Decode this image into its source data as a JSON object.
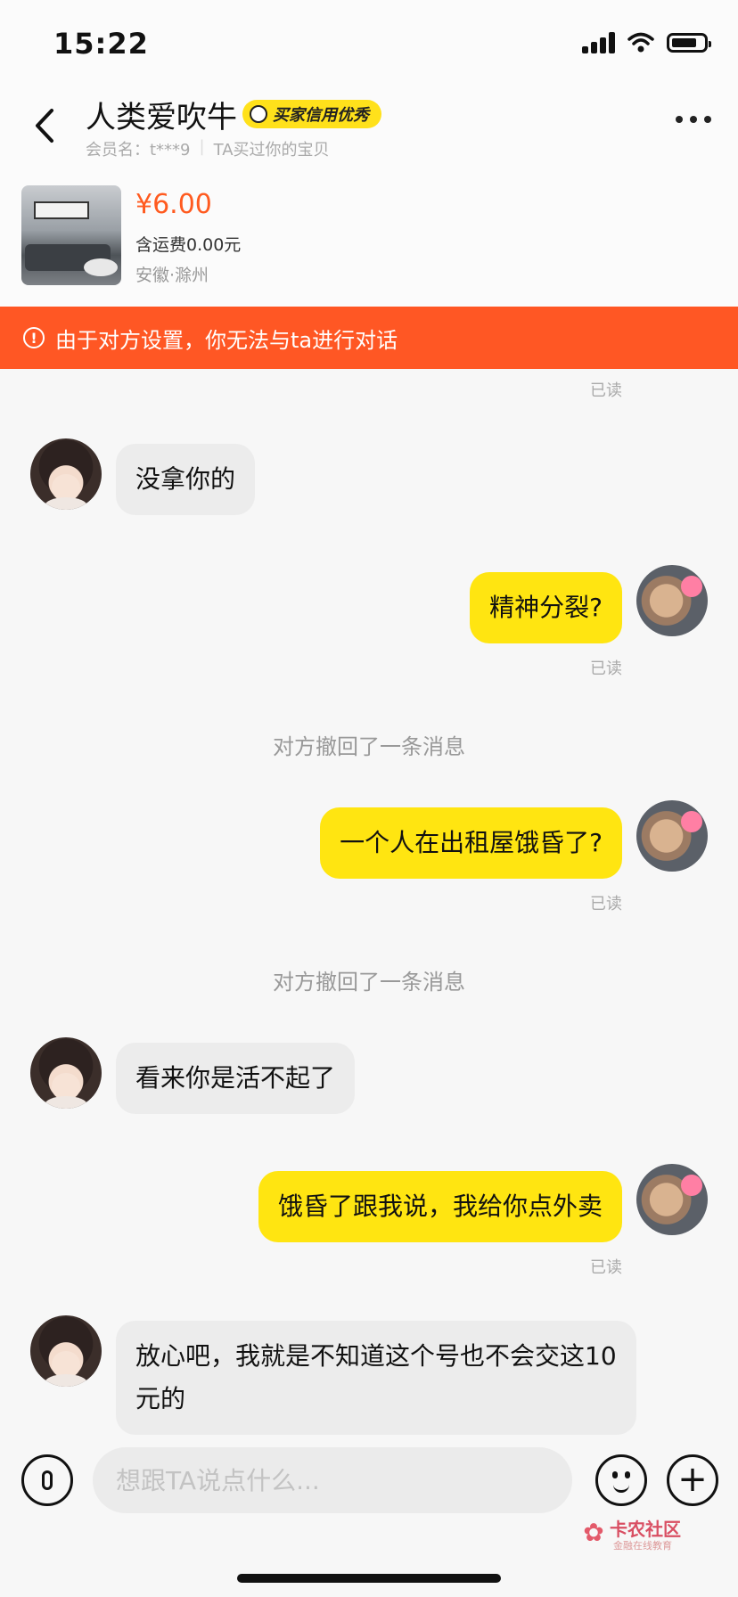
{
  "status_bar": {
    "time": "15:22"
  },
  "header": {
    "back_icon": "chevron-left-icon",
    "title": "人类爱吹牛",
    "badge": "买家信用优秀",
    "member_label": "会员名：",
    "member_name": "t***9",
    "bought_note": "TA买过你的宝贝",
    "more_icon": "more-dots-icon"
  },
  "product": {
    "price": "¥6.00",
    "shipping": "含运费0.00元",
    "location": "安徽·滁州"
  },
  "warning": {
    "icon": "alert-circle-icon",
    "text": "由于对方设置，你无法与ta进行对话"
  },
  "chat": {
    "read_label": "已读",
    "recall_text": "对方撤回了一条消息",
    "messages": [
      {
        "side": "left",
        "text": "没拿你的"
      },
      {
        "side": "right",
        "text": "精神分裂?"
      },
      {
        "side": "right",
        "text": "一个人在出租屋饿昏了?"
      },
      {
        "side": "left",
        "text": "看来你是活不起了"
      },
      {
        "side": "right",
        "text": "饿昏了跟我说，我给你点外卖"
      },
      {
        "side": "left",
        "text": "放心吧，我就是不知道这个号也不会交这10元的"
      }
    ]
  },
  "input_bar": {
    "placeholder": "想跟TA说点什么...",
    "voice_icon": "microphone-icon",
    "emoji_icon": "emoji-icon",
    "plus_icon": "plus-icon",
    "plus_glyph": "+"
  },
  "watermark": {
    "main": "卡农社区",
    "sub": "金融在线教育"
  },
  "colors": {
    "accent_yellow": "#ffe511",
    "warning_orange": "#ff5724",
    "price_orange": "#ff5a1f"
  }
}
